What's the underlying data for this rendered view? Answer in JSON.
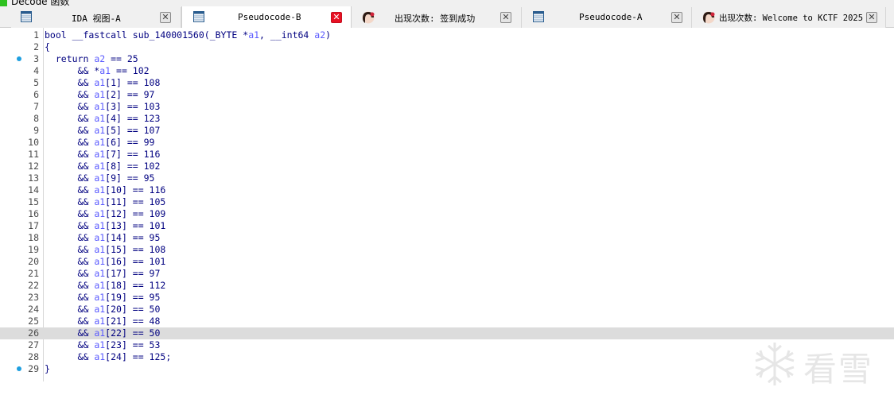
{
  "window": {
    "title": "Decode 函数"
  },
  "tabs": [
    {
      "label": "IDA 视图-A",
      "icon": "table-icon",
      "active": false
    },
    {
      "label": "Pseudocode-B",
      "icon": "table-icon",
      "active": true
    },
    {
      "label": "出现次数: 签到成功",
      "icon": "avatar-icon",
      "active": false
    },
    {
      "label": "Pseudocode-A",
      "icon": "table-icon",
      "active": false
    },
    {
      "label": "出现次数: Welcome to KCTF 2025",
      "icon": "avatar-icon",
      "active": false
    }
  ],
  "editor": {
    "current_line": 26,
    "breakpoint_lines": [
      3,
      29
    ],
    "lines": [
      {
        "n": "1",
        "text": "bool __fastcall sub_140001560(_BYTE *a1, __int64 a2)"
      },
      {
        "n": "2",
        "text": "{"
      },
      {
        "n": "3",
        "text": "  return a2 == 25"
      },
      {
        "n": "4",
        "text": "      && *a1 == 102"
      },
      {
        "n": "5",
        "text": "      && a1[1] == 108"
      },
      {
        "n": "6",
        "text": "      && a1[2] == 97"
      },
      {
        "n": "7",
        "text": "      && a1[3] == 103"
      },
      {
        "n": "8",
        "text": "      && a1[4] == 123"
      },
      {
        "n": "9",
        "text": "      && a1[5] == 107"
      },
      {
        "n": "10",
        "text": "      && a1[6] == 99"
      },
      {
        "n": "11",
        "text": "      && a1[7] == 116"
      },
      {
        "n": "12",
        "text": "      && a1[8] == 102"
      },
      {
        "n": "13",
        "text": "      && a1[9] == 95"
      },
      {
        "n": "14",
        "text": "      && a1[10] == 116"
      },
      {
        "n": "15",
        "text": "      && a1[11] == 105"
      },
      {
        "n": "16",
        "text": "      && a1[12] == 109"
      },
      {
        "n": "17",
        "text": "      && a1[13] == 101"
      },
      {
        "n": "18",
        "text": "      && a1[14] == 95"
      },
      {
        "n": "19",
        "text": "      && a1[15] == 108"
      },
      {
        "n": "20",
        "text": "      && a1[16] == 101"
      },
      {
        "n": "21",
        "text": "      && a1[17] == 97"
      },
      {
        "n": "22",
        "text": "      && a1[18] == 112"
      },
      {
        "n": "23",
        "text": "      && a1[19] == 95"
      },
      {
        "n": "24",
        "text": "      && a1[20] == 50"
      },
      {
        "n": "25",
        "text": "      && a1[21] == 48"
      },
      {
        "n": "26",
        "text": "      && a1[22] == 50"
      },
      {
        "n": "27",
        "text": "      && a1[23] == 53"
      },
      {
        "n": "28",
        "text": "      && a1[24] == 125;"
      },
      {
        "n": "29",
        "text": "}"
      }
    ]
  },
  "watermark": {
    "text": "看雪",
    "icon": "snowflake-icon"
  },
  "colors": {
    "keyword": "#000080",
    "variable": "#5a5aff",
    "comment_grey": "#808080",
    "active_close": "#e81123",
    "breakpoint": "#1e9fe0",
    "current_line_bg": "#dcdcdc"
  }
}
